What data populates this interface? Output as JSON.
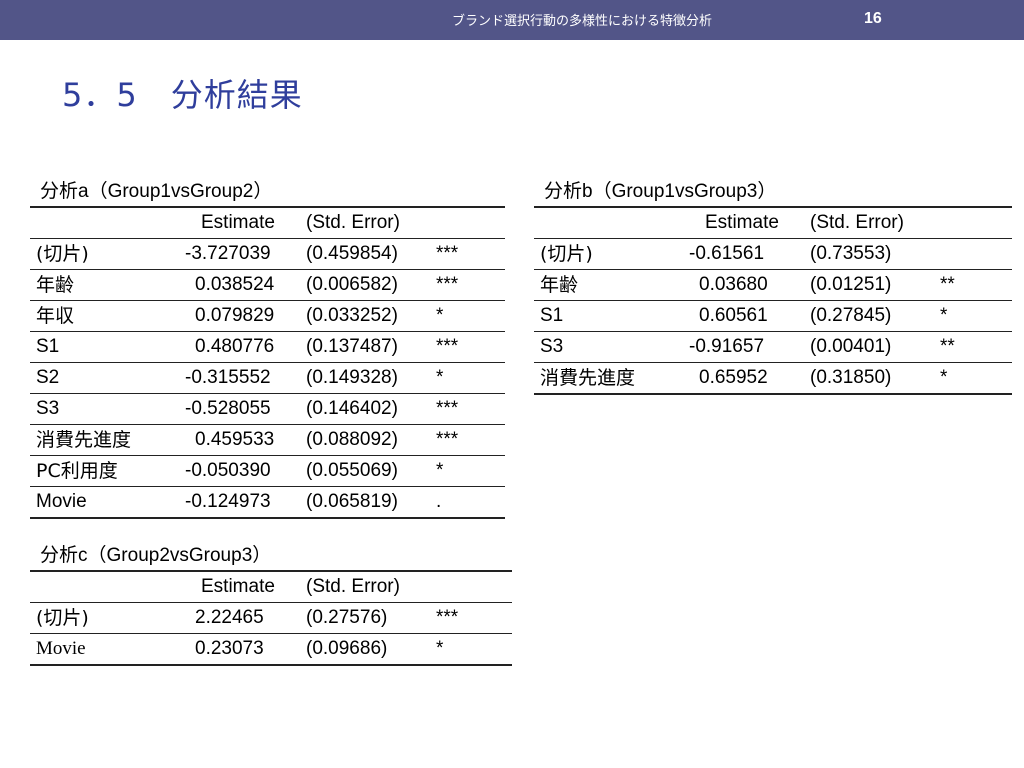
{
  "header": {
    "subtitle": "ブランド選択行動の多様性における特徴分析",
    "page_number": "16"
  },
  "title": "5．5　分析結果",
  "colors": {
    "header_bar": "#525588",
    "title": "#2f3e9c"
  },
  "tables": {
    "a": {
      "caption_prefix": "分析a",
      "caption_group": "（Group1vsGroup2）",
      "columns": [
        "",
        "Estimate",
        "(Std. Error)",
        ""
      ],
      "rows": [
        [
          "(切片)",
          "-3.727039",
          "(0.459854)",
          "***"
        ],
        [
          "年齢",
          "0.038524",
          "(0.006582)",
          "***"
        ],
        [
          "年収",
          "0.079829",
          "(0.033252)",
          "*"
        ],
        [
          "S1",
          "0.480776",
          "(0.137487)",
          "***"
        ],
        [
          "S2",
          "-0.315552",
          "(0.149328)",
          "*"
        ],
        [
          "S3",
          "-0.528055",
          "(0.146402)",
          "***"
        ],
        [
          "消費先進度",
          "0.459533",
          "(0.088092)",
          "***"
        ],
        [
          "PC利用度",
          "-0.050390",
          "(0.055069)",
          "*"
        ],
        [
          "Movie",
          "-0.124973",
          "(0.065819)",
          "."
        ]
      ]
    },
    "b": {
      "caption_prefix": "分析b",
      "caption_group": "（Group1vsGroup3）",
      "columns": [
        "",
        "Estimate",
        "(Std. Error)",
        ""
      ],
      "rows": [
        [
          "(切片)",
          "-0.61561",
          "(0.73553)",
          ""
        ],
        [
          "年齢",
          "0.03680",
          "(0.01251)",
          "**"
        ],
        [
          "S1",
          "0.60561",
          "(0.27845)",
          "*"
        ],
        [
          "S3",
          "-0.91657",
          "(0.00401)",
          "**"
        ],
        [
          "消費先進度",
          "0.65952",
          "(0.31850)",
          "*"
        ]
      ]
    },
    "c": {
      "caption_prefix": "分析c",
      "caption_group": "（Group2vsGroup3）",
      "columns": [
        "",
        "Estimate",
        "(Std. Error)",
        ""
      ],
      "rows": [
        [
          "(切片)",
          "2.22465",
          "(0.27576)",
          "***"
        ],
        [
          "Movie",
          "0.23073",
          "(0.09686)",
          "*"
        ]
      ]
    }
  }
}
